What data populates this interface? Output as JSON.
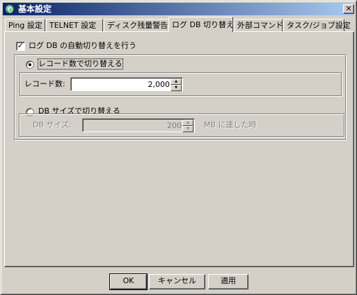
{
  "window": {
    "title": "基本設定",
    "close_glyph": "✕"
  },
  "tabs": [
    {
      "label": "Ping 設定",
      "active": false
    },
    {
      "label": "TELNET 設定",
      "active": false
    },
    {
      "label": "ディスク残量警告",
      "active": false
    },
    {
      "label": "ログ DB 切り替え",
      "active": true
    },
    {
      "label": "外部コマンド",
      "active": false
    },
    {
      "label": "タスク/ジョブ設定",
      "active": false
    }
  ],
  "panel": {
    "auto_switch": {
      "label": "ログ DB の自動切り替えを行う",
      "checked": true,
      "check_glyph": "✓"
    },
    "record_count_option": {
      "label": "レコード数で切り替える",
      "selected": true,
      "field_label": "レコード数:",
      "value": "2,000"
    },
    "db_size_option": {
      "label": "DB サイズで切り替える",
      "selected": false,
      "field_label": "DB サイズ:",
      "value": "200",
      "suffix": "MB に達した時"
    }
  },
  "spin_glyphs": {
    "up": "▲",
    "down": "▼"
  },
  "buttons": {
    "ok": "OK",
    "cancel": "キャンセル",
    "apply": "適用"
  }
}
